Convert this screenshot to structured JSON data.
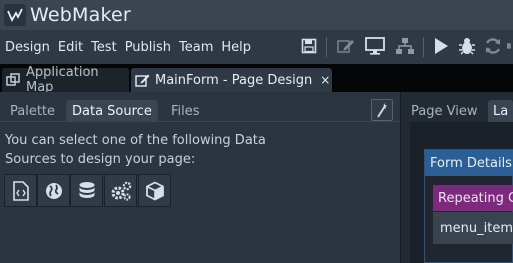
{
  "app": {
    "title": "WebMaker"
  },
  "menu": [
    "Design",
    "Edit",
    "Test",
    "Publish",
    "Team",
    "Help"
  ],
  "editor_tabs": {
    "application_map": "Application Map",
    "page_design": "MainForm - Page Design",
    "close_symbol": "×"
  },
  "left_panel": {
    "tabs": [
      "Palette",
      "Data Source",
      "Files"
    ],
    "active_tab": "Data Source",
    "description": "You can select one of the following Data Sources to design your page:",
    "data_sources": [
      "code-source-icon",
      "globe-icon",
      "database-icon",
      "services-gears-icon",
      "cube-icon"
    ]
  },
  "right_panel": {
    "tabs": [
      "Page View",
      "La"
    ],
    "form_details": "Form Details",
    "repeating": "Repeating C",
    "menu_item": "menu_item"
  },
  "colors": {
    "background": "#2b3440",
    "form_header": "#2b5f97",
    "repeating_header": "#7b2a7e"
  }
}
